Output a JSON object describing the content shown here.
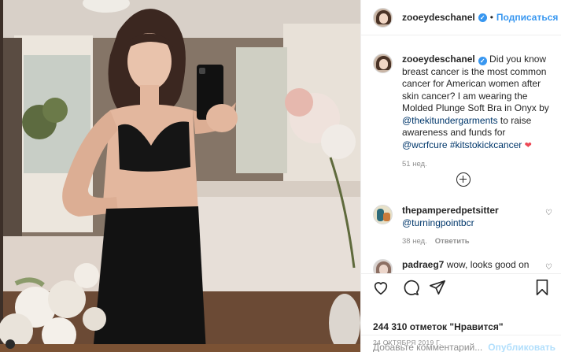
{
  "header": {
    "username": "zooeydeschanel",
    "follow_label": "Подписаться"
  },
  "caption": {
    "username": "zooeydeschanel",
    "text_1": "Did you know breast cancer is the most common cancer for American women after skin cancer? I am wearing the Molded Plunge Soft Bra in Onyx by ",
    "mention_1": "@thekitundergarments",
    "text_2": " to raise awareness and funds for ",
    "mention_2": "@wcrfcure",
    "hashtag": "#kitstokickcancer",
    "age": "51 нед."
  },
  "comments": [
    {
      "username": "thepamperedpetsitter",
      "text": "@turningpointbcr",
      "age": "38 нед.",
      "reply_label": "Ответить"
    },
    {
      "username": "padraeg7",
      "text": "wow, looks good on"
    }
  ],
  "actions": {
    "icons": [
      "heart-icon",
      "comment-icon",
      "share-icon",
      "bookmark-icon"
    ],
    "likes_text": "244 310 отметок \"Нравится\"",
    "date": "24 ОКТЯБРЯ 2019 Г."
  },
  "add_comment": {
    "placeholder": "Добавьте комментарий...",
    "publish_label": "Опубликовать"
  },
  "colors": {
    "accent": "#3897f0",
    "link": "#00376b",
    "muted": "#8e8e8e",
    "heart": "#ed4956",
    "publish_disabled": "#b2dffc"
  }
}
